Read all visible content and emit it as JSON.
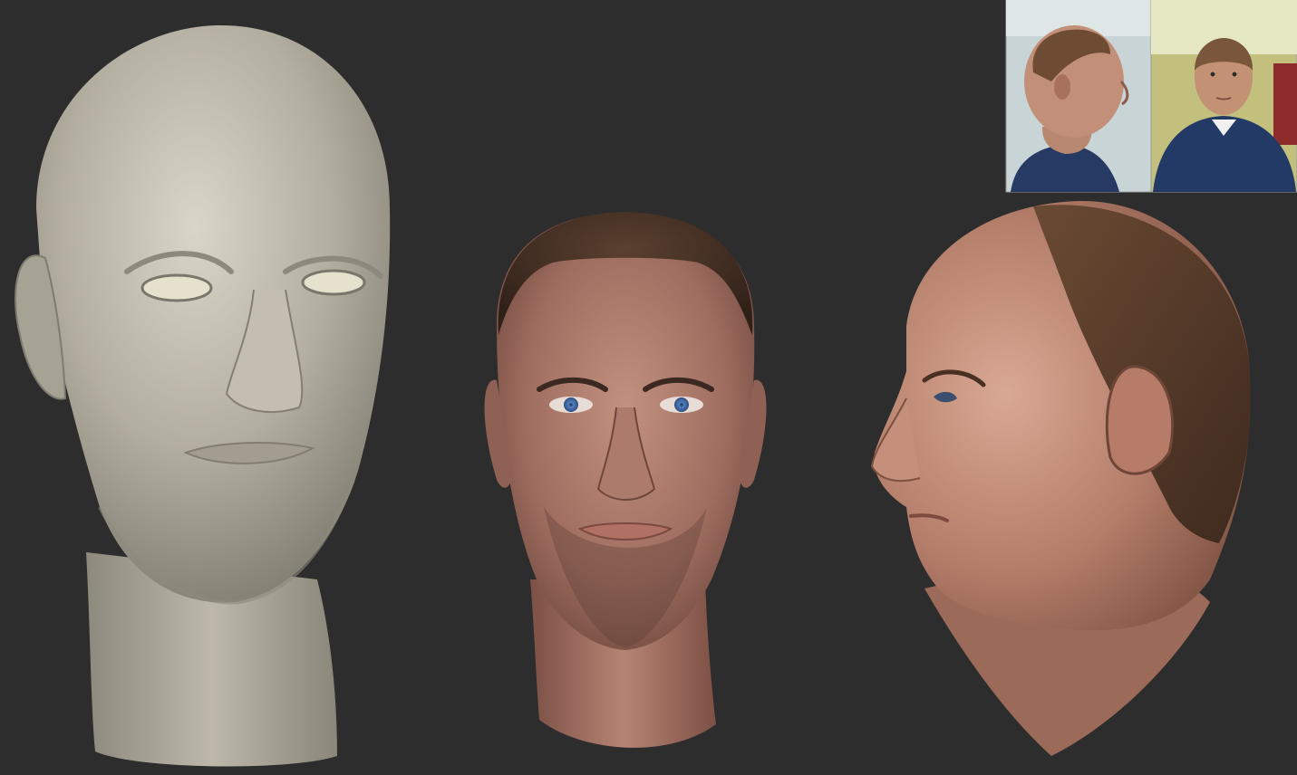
{
  "scene": {
    "background_color": "#2d2d2d",
    "renders": [
      {
        "name": "untextured-sculpt-front-three-quarter",
        "material": "clay",
        "base_color": "#b8b4a6",
        "eye_color": "#e6e1cc"
      },
      {
        "name": "textured-head-front",
        "material": "skin",
        "base_color": "#a47566",
        "hair_color": "#4a3426",
        "eye_color": "#5d88c8"
      },
      {
        "name": "textured-head-profile",
        "material": "skin",
        "base_color": "#b07c68",
        "hair_color": "#553a29"
      }
    ],
    "reference_photos": [
      {
        "name": "reference-photo-side",
        "shirt_color": "#263a63",
        "background_color": "#c9d4d6"
      },
      {
        "name": "reference-photo-front",
        "shirt_color": "#233a66",
        "background_color": "#c2c07c"
      }
    ]
  }
}
